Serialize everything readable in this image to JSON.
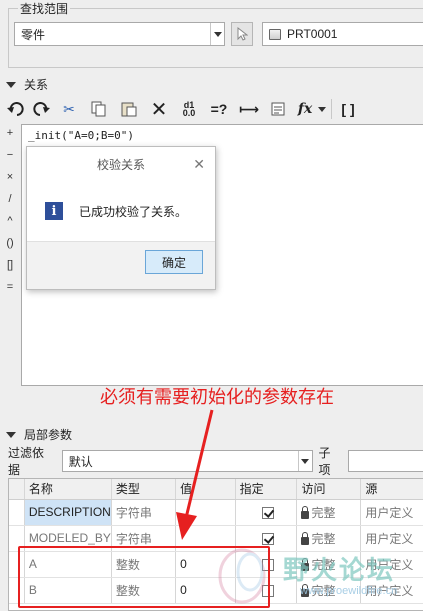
{
  "scope": {
    "title": "查找范围",
    "type_value": "零件",
    "part_value": "PRT0001"
  },
  "relations": {
    "title": "关系",
    "toolbar": [
      {
        "icon": "undo-icon",
        "glyph": "↶"
      },
      {
        "icon": "redo-icon",
        "glyph": "↷"
      },
      {
        "icon": "cut-icon",
        "glyph": "✂"
      },
      {
        "icon": "copy-icon",
        "glyph": "⧉"
      },
      {
        "icon": "paste-icon",
        "glyph": "📋"
      },
      {
        "icon": "delete-icon",
        "glyph": "✕"
      },
      {
        "icon": "units-icon",
        "glyph": "d1"
      },
      {
        "icon": "evaluate-icon",
        "glyph": "=?"
      },
      {
        "icon": "measure-icon",
        "glyph": "⟷"
      },
      {
        "icon": "sort-icon",
        "glyph": "▤"
      },
      {
        "icon": "function-icon",
        "glyph": "fx"
      },
      {
        "icon": "parentheses-icon",
        "glyph": "[ ]"
      }
    ],
    "operators": [
      "+",
      "−",
      "×",
      "/",
      "^",
      "()",
      "[]",
      "="
    ],
    "code_line": "_init(\"A=0;B=0\")"
  },
  "dialog": {
    "title": "校验关系",
    "message": "已成功校验了关系。",
    "ok_label": "确定"
  },
  "annotation": "必须有需要初始化的参数存在",
  "local_params": {
    "title": "局部参数",
    "filter_label": "过滤依据",
    "filter_value": "默认",
    "sub_label": "子项",
    "columns": [
      "名称",
      "类型",
      "值",
      "指定",
      "访问",
      "源"
    ],
    "rows": [
      {
        "name": "DESCRIPTION",
        "type": "字符串",
        "value": "",
        "designated": true,
        "access": "完整",
        "source": "用户定义"
      },
      {
        "name": "MODELED_BY",
        "type": "字符串",
        "value": "",
        "designated": true,
        "access": "完整",
        "source": "用户定义"
      },
      {
        "name": "A",
        "type": "整数",
        "value": "0",
        "designated": false,
        "access": "完整",
        "source": "用户定义"
      },
      {
        "name": "B",
        "type": "整数",
        "value": "0",
        "designated": false,
        "access": "完整",
        "source": "用户定义"
      }
    ]
  },
  "watermark": {
    "text": "野火论坛",
    "url": "www.proewildfire.cn"
  }
}
